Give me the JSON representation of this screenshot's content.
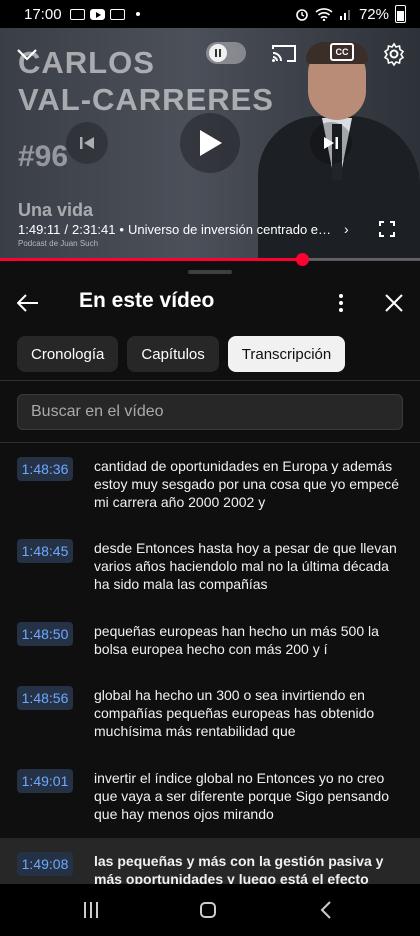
{
  "status_bar": {
    "time": "17:00",
    "battery": "72%"
  },
  "video": {
    "thumbnail": {
      "title_line1": "CARLOS",
      "title_line2": "VAL-CARRERES",
      "episode": "#96",
      "subtitle": "Una vida",
      "podcast": "Podcast de Juan Such"
    },
    "current_time": "1:49:11",
    "duration": "2:31:41",
    "separator": "/",
    "bullet": "•",
    "chapter": "Universo de inversión centrado en…",
    "progress": 0.72
  },
  "panel": {
    "title": "En este vídeo",
    "chips": [
      {
        "label": "Cronología",
        "active": false
      },
      {
        "label": "Capítulos",
        "active": false
      },
      {
        "label": "Transcripción",
        "active": true
      }
    ],
    "search_placeholder": "Buscar en el vídeo"
  },
  "transcript": [
    {
      "time": "1:48:36",
      "text": "cantidad de oportunidades en Europa y además estoy muy sesgado por una cosa que yo empecé mi carrera año 2000 2002 y"
    },
    {
      "time": "1:48:45",
      "text": "desde Entonces hasta hoy a pesar de que llevan varios años haciendolo mal no la última década ha sido mala las compañías"
    },
    {
      "time": "1:48:50",
      "text": "pequeñas europeas han hecho un más 500 la bolsa europea hecho con más 200 y í"
    },
    {
      "time": "1:48:56",
      "text": "global ha hecho un 300 o sea invirtiendo en compañías pequeñas europeas has obtenido muchísima más rentabilidad que"
    },
    {
      "time": "1:49:01",
      "text": "invertir el índice global no Entonces yo no creo que vaya a ser diferente porque Sigo pensando que hay menos ojos mirando"
    },
    {
      "time": "1:49:08",
      "text": "las pequeñas y más con la gestión pasiva y más oportunidades y luego está el efecto"
    }
  ]
}
